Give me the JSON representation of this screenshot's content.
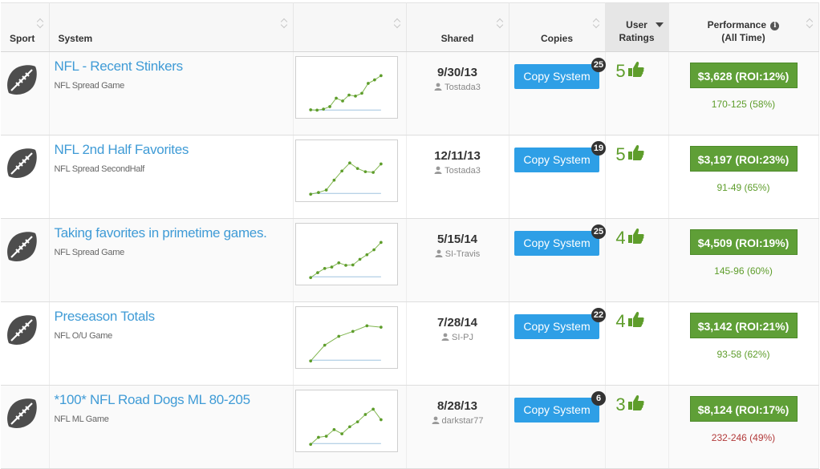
{
  "header": {
    "sport": "Sport",
    "system": "System",
    "shared": "Shared",
    "copies": "Copies",
    "ratings_line1": "User",
    "ratings_line2": "Ratings",
    "perf_line1": "Performance",
    "perf_line2": "(All Time)"
  },
  "copy_label": "Copy System",
  "colors": {
    "link": "#3f9bd6",
    "copy_button": "#2e9fe6",
    "perf_button": "#5f9f37",
    "positive": "#5e9d2b",
    "negative": "#b23a3a"
  },
  "rows": [
    {
      "sport_icon": "football-icon",
      "name": "NFL - Recent Stinkers",
      "type": "NFL Spread Game",
      "date": "9/30/13",
      "user": "Tostada3",
      "copies": "25",
      "rating": "5",
      "profit": "$3,628 (ROI:12%)",
      "record": "170-125 (58%)",
      "record_positive": true,
      "spark": [
        0.03,
        0.02,
        0.05,
        0.12,
        0.36,
        0.28,
        0.45,
        0.42,
        0.5,
        0.78,
        0.88,
        1.0
      ]
    },
    {
      "sport_icon": "football-icon",
      "name": "NFL 2nd Half Favorites",
      "type": "NFL Spread SecondHalf",
      "date": "12/11/13",
      "user": "Tostada3",
      "copies": "19",
      "rating": "5",
      "profit": "$3,197 (ROI:23%)",
      "record": "91-49 (65%)",
      "record_positive": true,
      "spark": [
        0.0,
        0.05,
        0.12,
        0.4,
        0.66,
        0.89,
        0.73,
        0.64,
        0.62,
        0.86
      ]
    },
    {
      "sport_icon": "football-icon",
      "name": "Taking favorites in primetime games.",
      "type": "NFL Spread Game",
      "date": "5/15/14",
      "user": "SI-Travis",
      "copies": "25",
      "rating": "4",
      "profit": "$4,509 (ROI:19%)",
      "record": "145-96 (60%)",
      "record_positive": true,
      "spark": [
        0.0,
        0.14,
        0.26,
        0.3,
        0.42,
        0.35,
        0.36,
        0.52,
        0.65,
        0.79,
        1.0
      ]
    },
    {
      "sport_icon": "football-icon",
      "name": "Preseason Totals",
      "type": "NFL O/U Game",
      "date": "7/28/14",
      "user": "SI-PJ",
      "copies": "22",
      "rating": "4",
      "profit": "$3,142 (ROI:21%)",
      "record": "93-58 (62%)",
      "record_positive": true,
      "spark": [
        0.0,
        0.45,
        0.7,
        0.84,
        1.0,
        0.96
      ]
    },
    {
      "sport_icon": "football-icon",
      "name": "*100* NFL Road Dogs ML 80-205",
      "type": "NFL ML Game",
      "date": "8/28/13",
      "user": "darkstar77",
      "copies": "6",
      "rating": "3",
      "profit": "$8,124 (ROI:17%)",
      "record": "232-246 (49%)",
      "record_positive": false,
      "spark": [
        0.0,
        0.2,
        0.23,
        0.42,
        0.3,
        0.5,
        0.64,
        0.85,
        1.0,
        0.7
      ]
    }
  ]
}
